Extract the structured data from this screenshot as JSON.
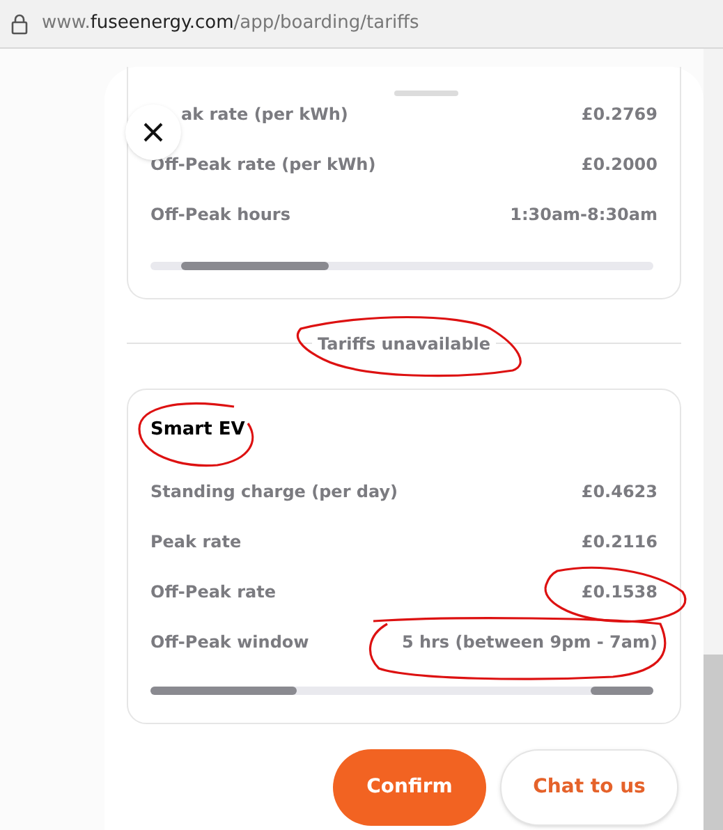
{
  "browser": {
    "url": "www.**fuseenergy.com**/app/boarding/tariffs"
  },
  "current_tariff": {
    "rows": [
      {
        "label": "ak rate (per kWh)",
        "value": "£0.2769"
      },
      {
        "label": "Off-Peak rate (per kWh)",
        "value": "£0.2000"
      },
      {
        "label": "Off-Peak hours",
        "value": "1:30am-8:30am"
      }
    ]
  },
  "separator": "Tariffs unavailable",
  "unavailable_tariff": {
    "title": "Smart EV",
    "rows": [
      {
        "label": "Standing charge (per day)",
        "value": "£0.4623"
      },
      {
        "label": "Peak rate",
        "value": "£0.2116"
      },
      {
        "label": "Off-Peak rate",
        "value": "£0.1538"
      },
      {
        "label": "Off-Peak window",
        "value": "5 hrs (between 9pm - 7am)"
      }
    ]
  },
  "buttons": [
    {
      "label": "Confirm",
      "kind": "primary"
    },
    {
      "label": "Chat to us",
      "kind": "secondary"
    }
  ]
}
